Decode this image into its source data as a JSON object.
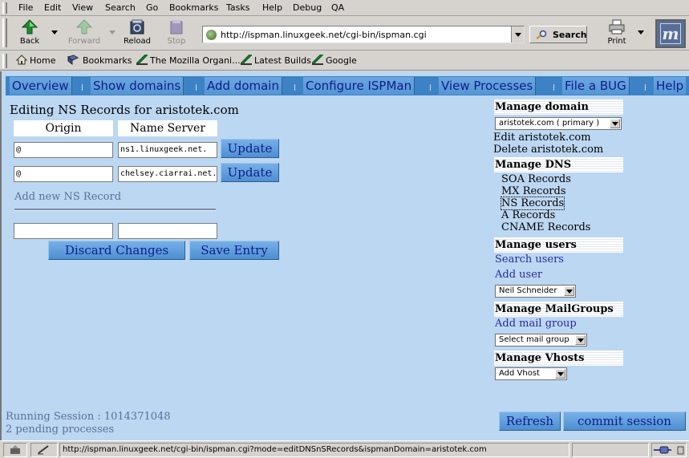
{
  "browser": {
    "menu": [
      {
        "label": "File"
      },
      {
        "label": "Edit"
      },
      {
        "label": "View"
      },
      {
        "label": "Search"
      },
      {
        "label": "Go"
      },
      {
        "label": "Bookmarks"
      },
      {
        "label": "Tasks"
      },
      {
        "label": "Help"
      },
      {
        "label": "Debug"
      },
      {
        "label": "QA"
      }
    ],
    "toolbar": {
      "back": "Back",
      "forward": "Forward",
      "reload": "Reload",
      "stop": "Stop",
      "print": "Print",
      "search": "Search"
    },
    "url": "http://ispman.linuxgeek.net/cgi-bin/ispman.cgi",
    "bookmarks": [
      {
        "label": "Home"
      },
      {
        "label": "Bookmarks"
      },
      {
        "label": "The Mozilla Organi..."
      },
      {
        "label": "Latest Builds"
      },
      {
        "label": "Google"
      }
    ],
    "status_url": "http://ispman.linuxgeek.net/cgi-bin/ispman.cgi?mode=editDNSnSRecords&ispmanDomain=aristotek.com"
  },
  "nav": [
    {
      "label": "Overview"
    },
    {
      "label": "Show domains"
    },
    {
      "label": "Add domain"
    },
    {
      "label": "Configure ISPMan"
    },
    {
      "label": "View Processes"
    },
    {
      "label": "File a BUG"
    },
    {
      "label": "Help"
    }
  ],
  "editor": {
    "title": "Editing NS Records for aristotek.com",
    "col_origin": "Origin",
    "col_nameserver": "Name Server",
    "rows": [
      {
        "origin": "@",
        "nameserver": "ns1.linuxgeek.net."
      },
      {
        "origin": "@",
        "nameserver": "chelsey.ciarrai.net."
      }
    ],
    "update_label": "Update",
    "add_new_label": "Add new NS Record",
    "discard_label": "Discard Changes",
    "save_label": "Save Entry"
  },
  "sidebar": {
    "manage_domain": "Manage domain",
    "domain_select": "aristotek.com ( primary )",
    "edit_domain": "Edit aristotek.com",
    "delete_domain": "Delete aristotek.com",
    "manage_dns": "Manage DNS",
    "dns_links": [
      {
        "label": "SOA Records"
      },
      {
        "label": "MX Records"
      },
      {
        "label": "NS Records"
      },
      {
        "label": "A Records"
      },
      {
        "label": "CNAME Records"
      }
    ],
    "manage_users": "Manage users",
    "search_users": "Search users",
    "add_user": "Add user",
    "user_select": "Neil Schneider",
    "manage_mailgroups": "Manage MailGroups",
    "add_mailgroup": "Add mail group",
    "mailgroup_select": "Select mail group",
    "manage_vhosts": "Manage Vhosts",
    "vhost_select": "Add Vhost"
  },
  "footer": {
    "session": "Running Session : 1014371048",
    "pending": "2 pending processes",
    "refresh": "Refresh",
    "commit": "commit session"
  }
}
